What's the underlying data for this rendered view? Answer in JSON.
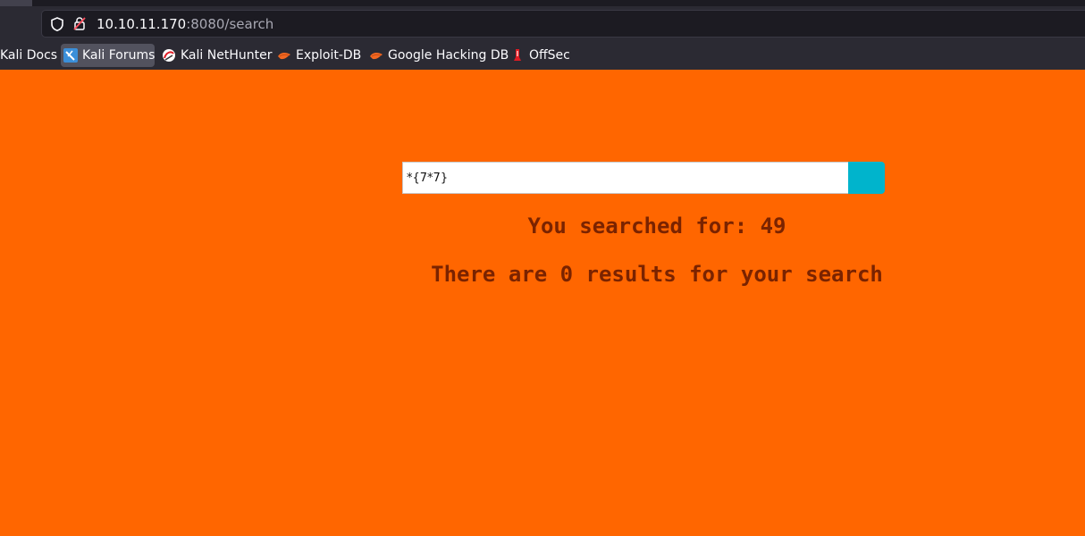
{
  "browser": {
    "url_host": "10.10.11.170",
    "url_rest": ":8080/search",
    "bookmarks": [
      {
        "label": "Kali Docs",
        "icon": "kali-docs-icon"
      },
      {
        "label": "Kali Forums",
        "icon": "kali-forums-icon"
      },
      {
        "label": "Kali NetHunter",
        "icon": "nethunter-icon"
      },
      {
        "label": "Exploit-DB",
        "icon": "exploit-db-icon"
      },
      {
        "label": "Google Hacking DB",
        "icon": "ghdb-icon"
      },
      {
        "label": "OffSec",
        "icon": "offsec-icon"
      }
    ]
  },
  "page": {
    "search_value": "*{7*7}",
    "searched_for_text": "You searched for: 49",
    "results_text": "There are 0 results for your search"
  },
  "colors": {
    "background": "#ff6600",
    "button": "#00b4cc",
    "result_text": "#7a2300"
  }
}
